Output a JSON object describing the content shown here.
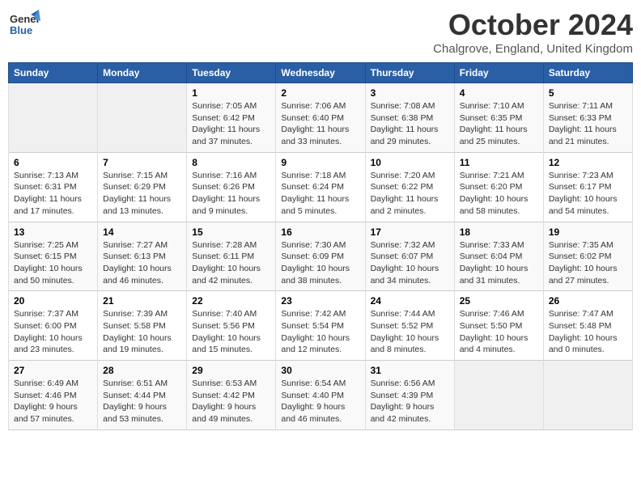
{
  "logo": {
    "line1": "General",
    "line2": "Blue"
  },
  "title": "October 2024",
  "location": "Chalgrove, England, United Kingdom",
  "days_of_week": [
    "Sunday",
    "Monday",
    "Tuesday",
    "Wednesday",
    "Thursday",
    "Friday",
    "Saturday"
  ],
  "weeks": [
    [
      {
        "num": "",
        "info": ""
      },
      {
        "num": "",
        "info": ""
      },
      {
        "num": "1",
        "info": "Sunrise: 7:05 AM\nSunset: 6:42 PM\nDaylight: 11 hours\nand 37 minutes."
      },
      {
        "num": "2",
        "info": "Sunrise: 7:06 AM\nSunset: 6:40 PM\nDaylight: 11 hours\nand 33 minutes."
      },
      {
        "num": "3",
        "info": "Sunrise: 7:08 AM\nSunset: 6:38 PM\nDaylight: 11 hours\nand 29 minutes."
      },
      {
        "num": "4",
        "info": "Sunrise: 7:10 AM\nSunset: 6:35 PM\nDaylight: 11 hours\nand 25 minutes."
      },
      {
        "num": "5",
        "info": "Sunrise: 7:11 AM\nSunset: 6:33 PM\nDaylight: 11 hours\nand 21 minutes."
      }
    ],
    [
      {
        "num": "6",
        "info": "Sunrise: 7:13 AM\nSunset: 6:31 PM\nDaylight: 11 hours\nand 17 minutes."
      },
      {
        "num": "7",
        "info": "Sunrise: 7:15 AM\nSunset: 6:29 PM\nDaylight: 11 hours\nand 13 minutes."
      },
      {
        "num": "8",
        "info": "Sunrise: 7:16 AM\nSunset: 6:26 PM\nDaylight: 11 hours\nand 9 minutes."
      },
      {
        "num": "9",
        "info": "Sunrise: 7:18 AM\nSunset: 6:24 PM\nDaylight: 11 hours\nand 5 minutes."
      },
      {
        "num": "10",
        "info": "Sunrise: 7:20 AM\nSunset: 6:22 PM\nDaylight: 11 hours\nand 2 minutes."
      },
      {
        "num": "11",
        "info": "Sunrise: 7:21 AM\nSunset: 6:20 PM\nDaylight: 10 hours\nand 58 minutes."
      },
      {
        "num": "12",
        "info": "Sunrise: 7:23 AM\nSunset: 6:17 PM\nDaylight: 10 hours\nand 54 minutes."
      }
    ],
    [
      {
        "num": "13",
        "info": "Sunrise: 7:25 AM\nSunset: 6:15 PM\nDaylight: 10 hours\nand 50 minutes."
      },
      {
        "num": "14",
        "info": "Sunrise: 7:27 AM\nSunset: 6:13 PM\nDaylight: 10 hours\nand 46 minutes."
      },
      {
        "num": "15",
        "info": "Sunrise: 7:28 AM\nSunset: 6:11 PM\nDaylight: 10 hours\nand 42 minutes."
      },
      {
        "num": "16",
        "info": "Sunrise: 7:30 AM\nSunset: 6:09 PM\nDaylight: 10 hours\nand 38 minutes."
      },
      {
        "num": "17",
        "info": "Sunrise: 7:32 AM\nSunset: 6:07 PM\nDaylight: 10 hours\nand 34 minutes."
      },
      {
        "num": "18",
        "info": "Sunrise: 7:33 AM\nSunset: 6:04 PM\nDaylight: 10 hours\nand 31 minutes."
      },
      {
        "num": "19",
        "info": "Sunrise: 7:35 AM\nSunset: 6:02 PM\nDaylight: 10 hours\nand 27 minutes."
      }
    ],
    [
      {
        "num": "20",
        "info": "Sunrise: 7:37 AM\nSunset: 6:00 PM\nDaylight: 10 hours\nand 23 minutes."
      },
      {
        "num": "21",
        "info": "Sunrise: 7:39 AM\nSunset: 5:58 PM\nDaylight: 10 hours\nand 19 minutes."
      },
      {
        "num": "22",
        "info": "Sunrise: 7:40 AM\nSunset: 5:56 PM\nDaylight: 10 hours\nand 15 minutes."
      },
      {
        "num": "23",
        "info": "Sunrise: 7:42 AM\nSunset: 5:54 PM\nDaylight: 10 hours\nand 12 minutes."
      },
      {
        "num": "24",
        "info": "Sunrise: 7:44 AM\nSunset: 5:52 PM\nDaylight: 10 hours\nand 8 minutes."
      },
      {
        "num": "25",
        "info": "Sunrise: 7:46 AM\nSunset: 5:50 PM\nDaylight: 10 hours\nand 4 minutes."
      },
      {
        "num": "26",
        "info": "Sunrise: 7:47 AM\nSunset: 5:48 PM\nDaylight: 10 hours\nand 0 minutes."
      }
    ],
    [
      {
        "num": "27",
        "info": "Sunrise: 6:49 AM\nSunset: 4:46 PM\nDaylight: 9 hours\nand 57 minutes."
      },
      {
        "num": "28",
        "info": "Sunrise: 6:51 AM\nSunset: 4:44 PM\nDaylight: 9 hours\nand 53 minutes."
      },
      {
        "num": "29",
        "info": "Sunrise: 6:53 AM\nSunset: 4:42 PM\nDaylight: 9 hours\nand 49 minutes."
      },
      {
        "num": "30",
        "info": "Sunrise: 6:54 AM\nSunset: 4:40 PM\nDaylight: 9 hours\nand 46 minutes."
      },
      {
        "num": "31",
        "info": "Sunrise: 6:56 AM\nSunset: 4:39 PM\nDaylight: 9 hours\nand 42 minutes."
      },
      {
        "num": "",
        "info": ""
      },
      {
        "num": "",
        "info": ""
      }
    ]
  ]
}
